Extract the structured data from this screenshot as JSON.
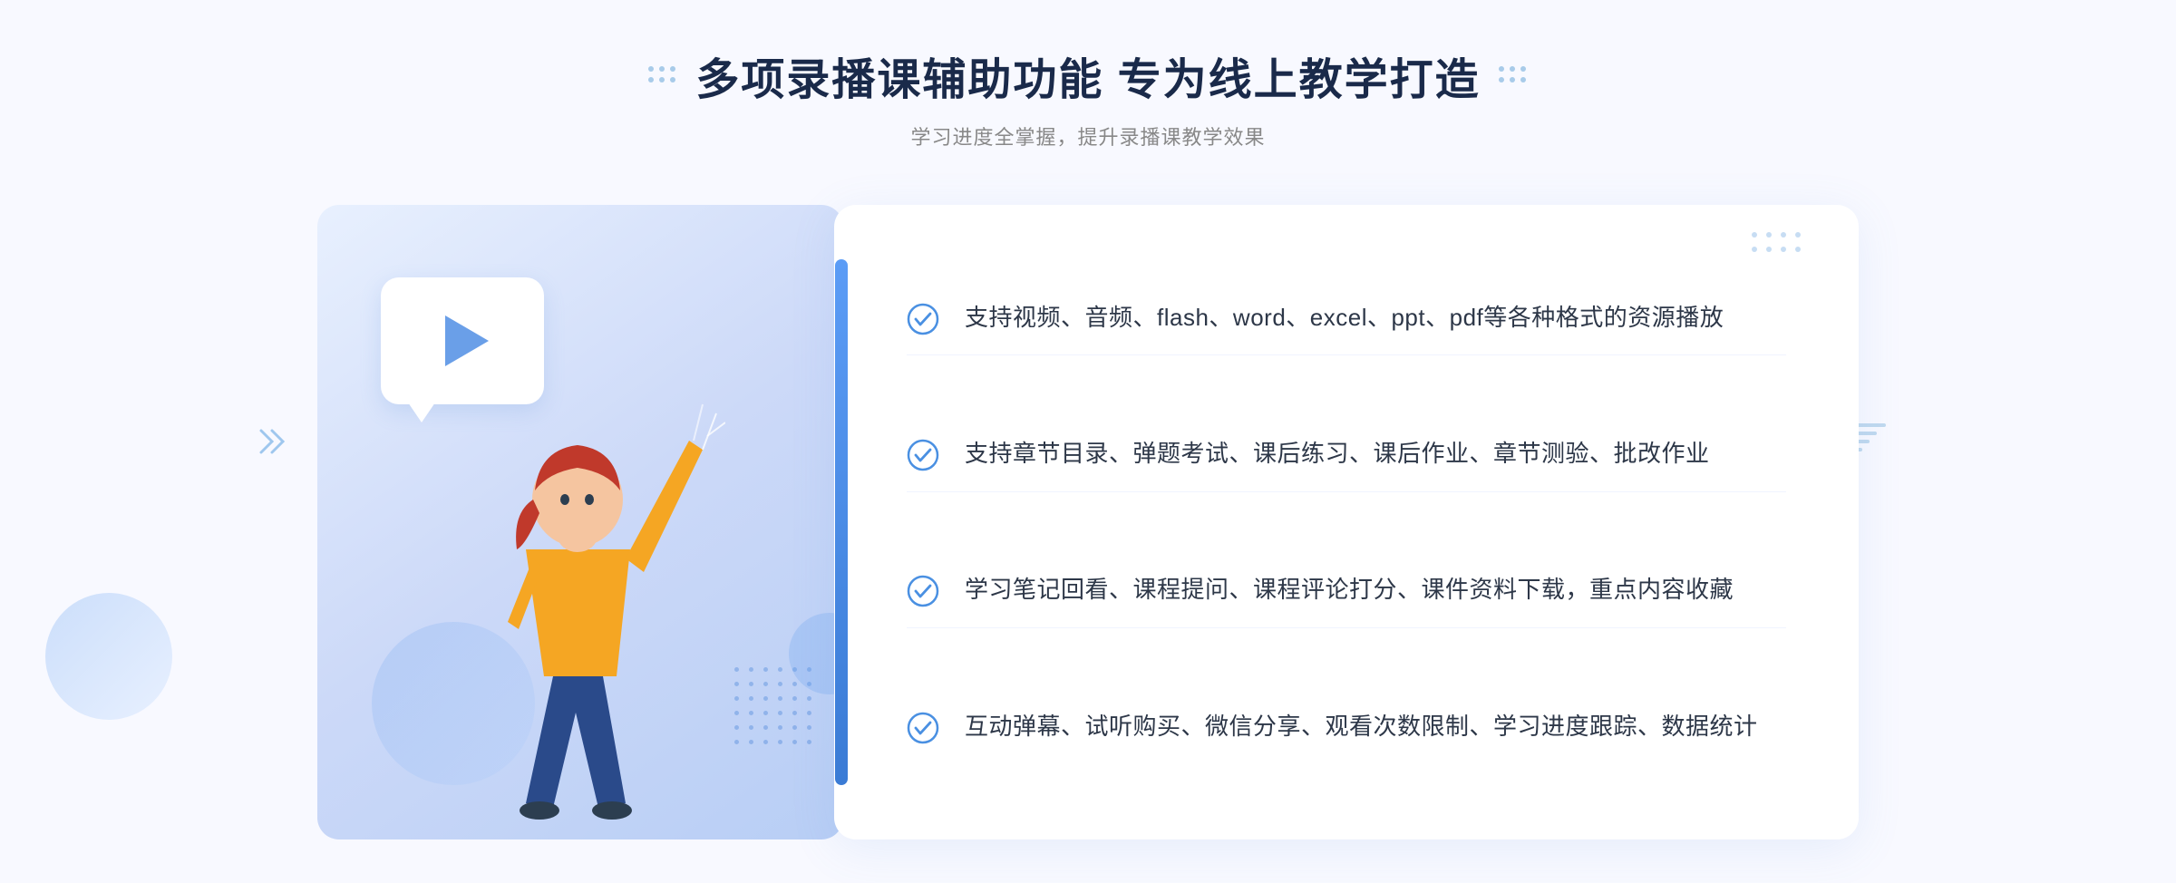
{
  "page": {
    "background_color": "#f5f7ff"
  },
  "header": {
    "title": "多项录播课辅助功能 专为线上教学打造",
    "subtitle": "学习进度全掌握，提升录播课教学效果",
    "deco_left": "decorative-dots-left",
    "deco_right": "decorative-dots-right"
  },
  "features": [
    {
      "id": 1,
      "text": "支持视频、音频、flash、word、excel、ppt、pdf等各种格式的资源播放"
    },
    {
      "id": 2,
      "text": "支持章节目录、弹题考试、课后练习、课后作业、章节测验、批改作业"
    },
    {
      "id": 3,
      "text": "学习笔记回看、课程提问、课程评论打分、课件资料下载，重点内容收藏"
    },
    {
      "id": 4,
      "text": "互动弹幕、试听购买、微信分享、观看次数限制、学习进度跟踪、数据统计"
    }
  ],
  "illustration": {
    "play_button_label": "play",
    "alt_text": "online teaching illustration"
  },
  "colors": {
    "primary_blue": "#3a7bd5",
    "light_blue": "#6a9fe8",
    "check_color": "#4a90e2",
    "title_color": "#1a2a4a",
    "text_color": "#2d3748",
    "subtitle_color": "#999999"
  }
}
